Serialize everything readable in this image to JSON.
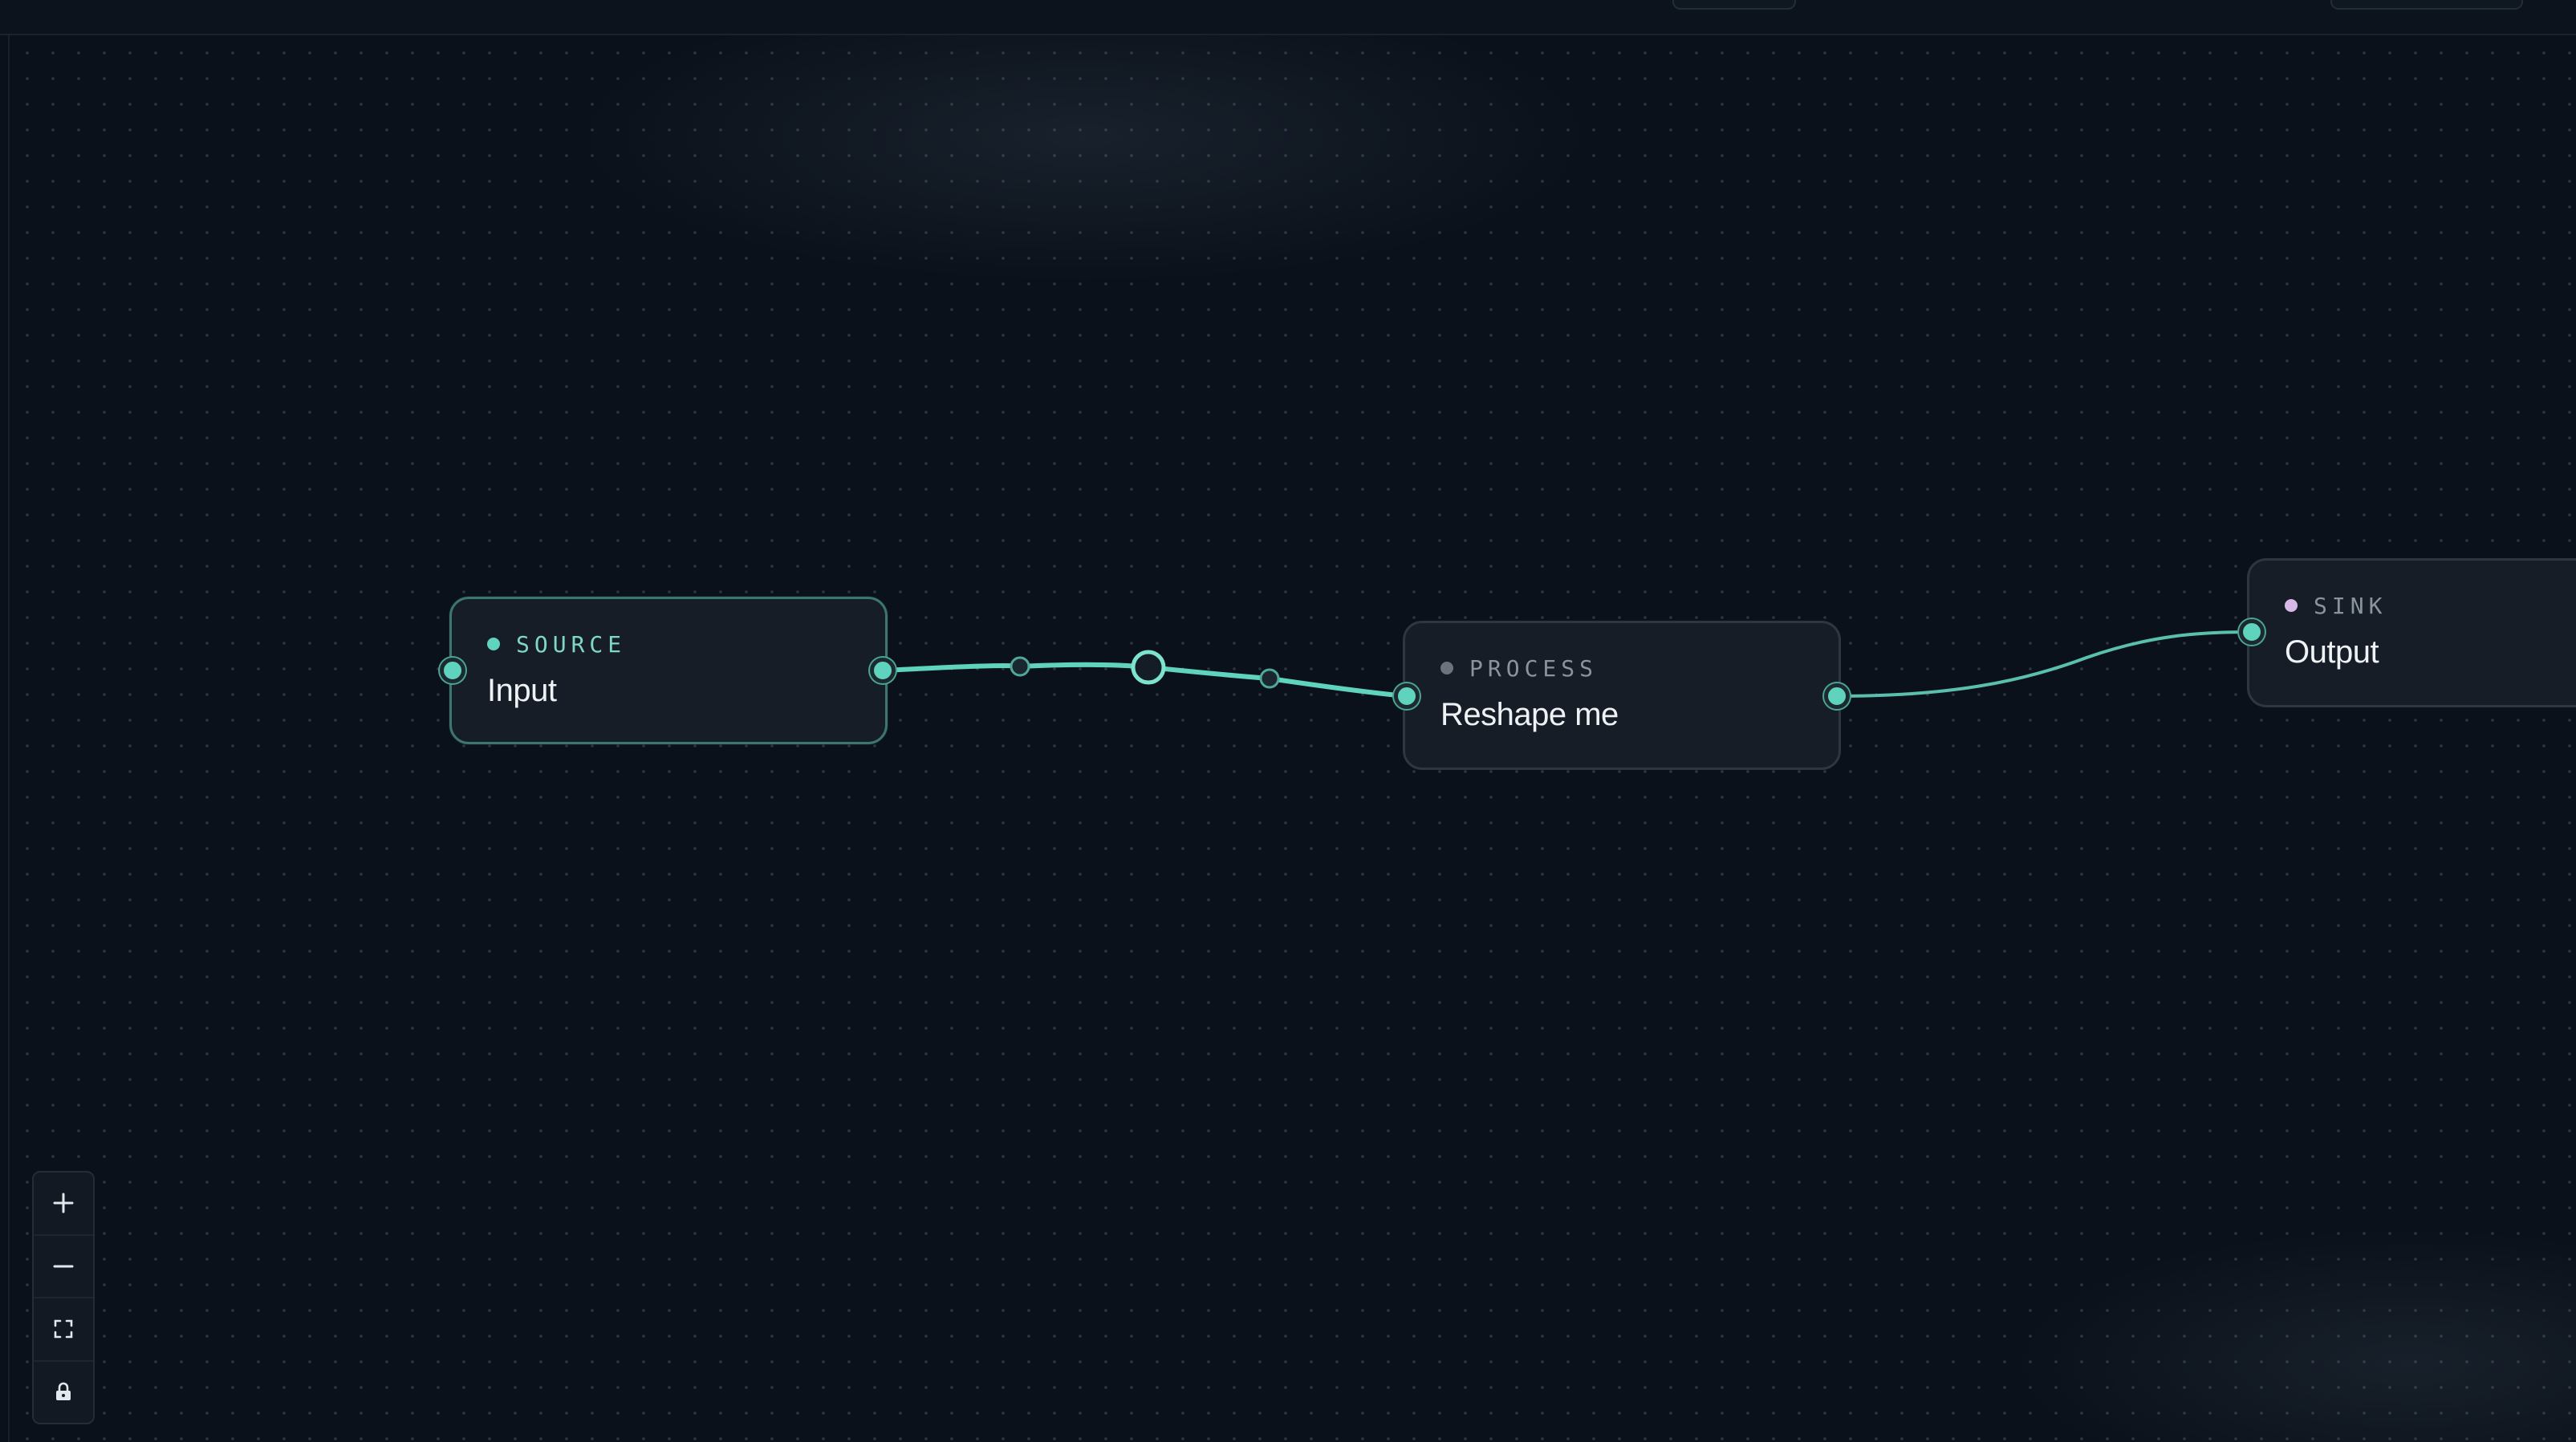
{
  "colors": {
    "background": "#0b111a",
    "node_fill": "#161d26",
    "node_border": "#2d3641",
    "accent": "#5fd3bd",
    "source_dot": "#5fd3bd",
    "process_dot": "#6b747e",
    "sink_dot": "#d9b7e6",
    "text": "#eef2f5",
    "muted_text": "#8a939e"
  },
  "nodes": {
    "source": {
      "kind": "SOURCE",
      "title": "Input"
    },
    "process": {
      "kind": "PROCESS",
      "title": "Reshape me"
    },
    "sink": {
      "kind": "SINK",
      "title": "Output"
    }
  },
  "controls": {
    "zoom_in_icon": "plus-icon",
    "zoom_out_icon": "minus-icon",
    "fit_view_icon": "fit-view-icon",
    "lock_icon": "lock-icon"
  }
}
